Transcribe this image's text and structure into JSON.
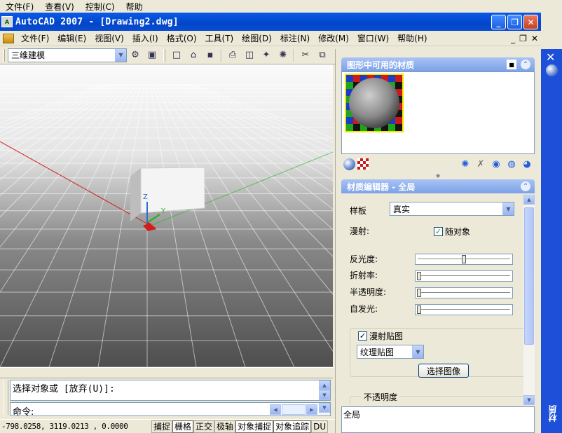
{
  "host_menu": [
    "文件(F)",
    "查看(V)",
    "控制(C)",
    "帮助"
  ],
  "window": {
    "title": "AutoCAD 2007 - [Drawing2.dwg]",
    "buttons": [
      "_",
      "❐",
      "✕"
    ]
  },
  "menu": {
    "items": [
      "文件(F)",
      "编辑(E)",
      "视图(V)",
      "插入(I)",
      "格式(O)",
      "工具(T)",
      "绘图(D)",
      "标注(N)",
      "修改(M)",
      "窗口(W)",
      "帮助(H)"
    ],
    "mdi_controls": [
      "_",
      "❐",
      "✕"
    ]
  },
  "toolbar": {
    "workspace": "三维建模",
    "tools": [
      {
        "icon": "new-icon",
        "glyph": "□"
      },
      {
        "icon": "open-icon",
        "glyph": "⌂"
      },
      {
        "icon": "save-icon",
        "glyph": "▪"
      },
      {
        "icon": "print-icon",
        "glyph": "⎙"
      },
      {
        "icon": "preview-icon",
        "glyph": "◫"
      },
      {
        "icon": "publish-icon",
        "glyph": "✦"
      },
      {
        "icon": "3d-dwf-icon",
        "glyph": "✺"
      },
      {
        "icon": "cut-icon",
        "glyph": "✂"
      },
      {
        "icon": "copy-icon",
        "glyph": "⧉"
      }
    ]
  },
  "viewport": {
    "ucs_labels": {
      "z": "Z",
      "y": "Y"
    },
    "colors": {
      "box_front": "#f4f4f4",
      "box_side": "#b8b8b8",
      "box_top": "#a0a0a0",
      "axis_red": "#d31d1d",
      "axis_green": "#1db31d",
      "axis_blue": "#2c6fd6"
    }
  },
  "command": {
    "history": "选择对象或 [放弃(U)]:",
    "prompt": "命令:"
  },
  "status": {
    "coords": "-798.0258,   3119.0213 , 0.0000",
    "toggles": [
      {
        "label": "捕捉",
        "on": false
      },
      {
        "label": "栅格",
        "on": true
      },
      {
        "label": "正交",
        "on": false
      },
      {
        "label": "极轴",
        "on": false
      },
      {
        "label": "对象捕捉",
        "on": true
      },
      {
        "label": "对象追踪",
        "on": true
      },
      {
        "label": "DU",
        "on": false
      }
    ]
  },
  "materials_palette": {
    "available_header": "图形中可用的材质",
    "editor_header": "材质编辑器 - 全局",
    "template_label": "样板",
    "template_value": "真实",
    "diffuse_label": "漫射:",
    "by_object_label": "随对象",
    "by_object_checked": true,
    "sliders": [
      {
        "label": "反光度:",
        "level": 0.5
      },
      {
        "label": "折射率:",
        "level": 0.0
      },
      {
        "label": "半透明度:",
        "level": 0.0
      },
      {
        "label": "自发光:",
        "level": 0.0
      }
    ],
    "diffuse_map_label": "漫射贴图",
    "diffuse_map_checked": true,
    "map_type": "纹理贴图",
    "select_image_label": "选择图像",
    "opacity_label": "不透明度",
    "bottom_text": "全局",
    "side_label": "材质",
    "close_glyph": "✕"
  }
}
